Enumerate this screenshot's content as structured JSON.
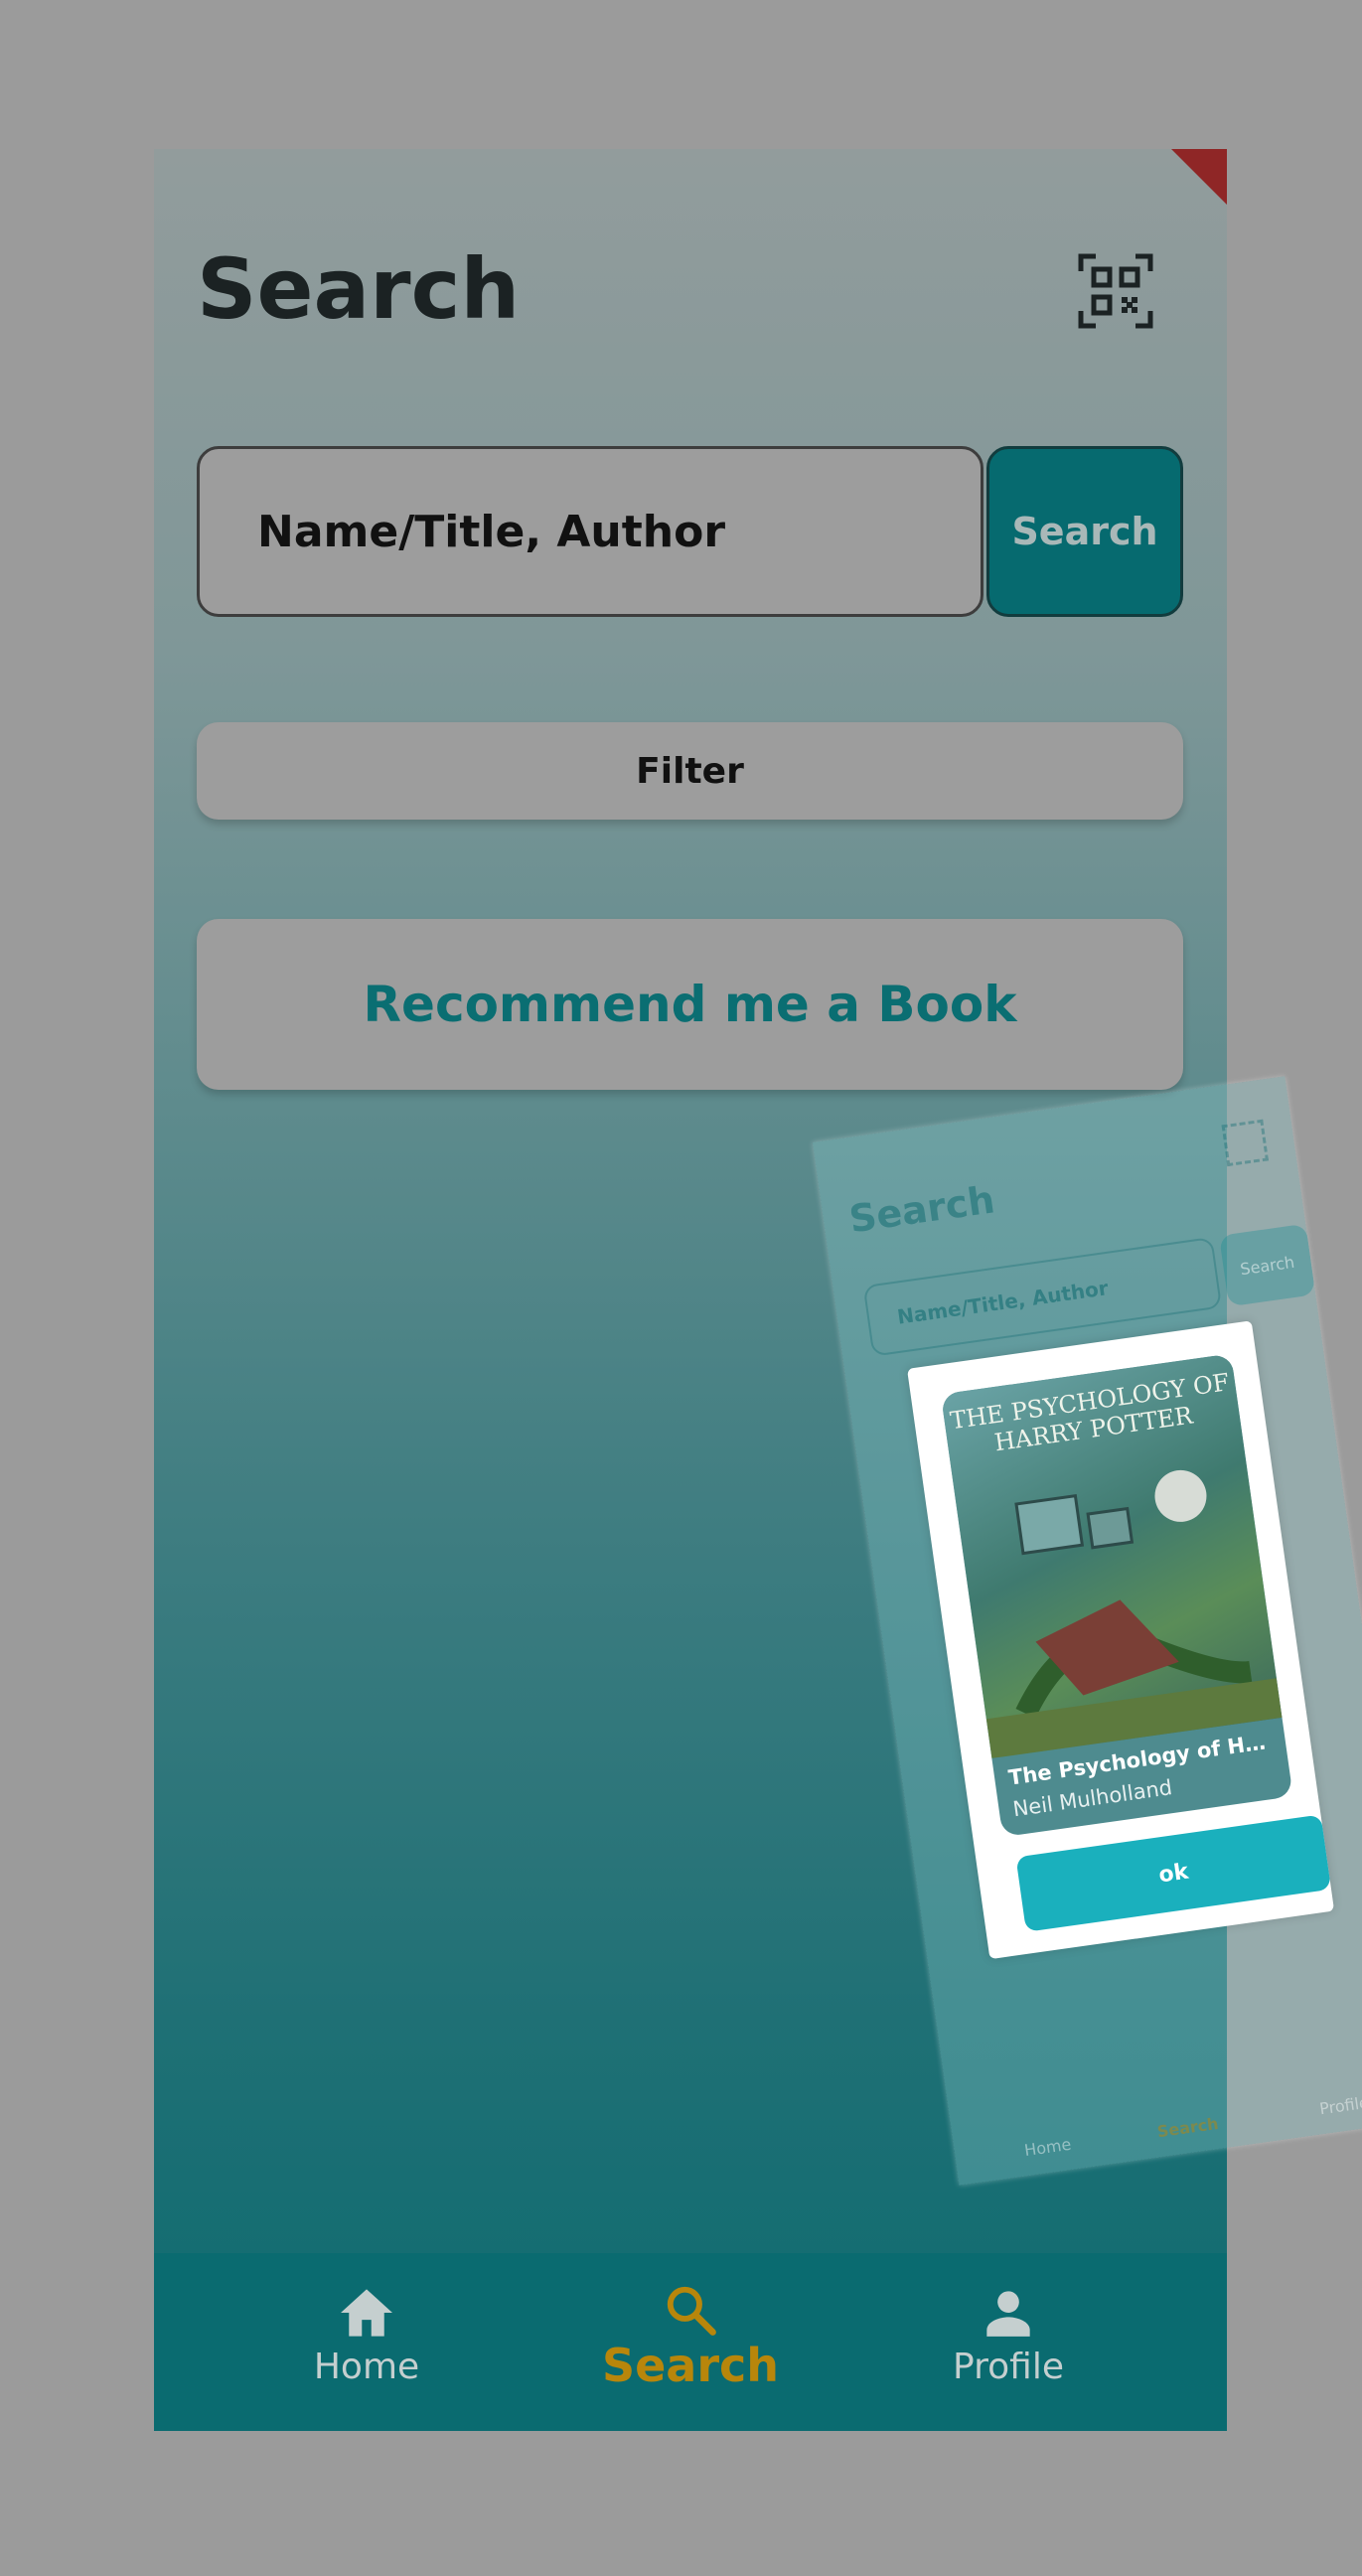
{
  "page": {
    "title": "Search"
  },
  "search": {
    "placeholder": "Name/Title, Author",
    "button_label": "Search"
  },
  "filter": {
    "label": "Filter"
  },
  "recommend": {
    "label": "Recommend me a Book"
  },
  "nav": {
    "items": [
      {
        "label": "Home",
        "icon": "home-icon",
        "active": false
      },
      {
        "label": "Search",
        "icon": "search-icon",
        "active": true
      },
      {
        "label": "Profile",
        "icon": "person-icon",
        "active": false
      }
    ]
  },
  "overlay": {
    "title": "Search",
    "search_placeholder": "Name/Title, Author",
    "search_button": "Search",
    "nav": [
      "Home",
      "Search",
      "Profile"
    ]
  },
  "popup": {
    "cover_title": "THE PSYCHOLOGY OF HARRY POTTER",
    "book_title": "The Psychology of Ha...",
    "author": "Neil Mulholland",
    "ok_label": "ok"
  },
  "colors": {
    "teal": "#0a6b70",
    "active_nav": "#b8860b",
    "corner_banner": "#8f2626",
    "ok_button": "#1ab0bd"
  }
}
